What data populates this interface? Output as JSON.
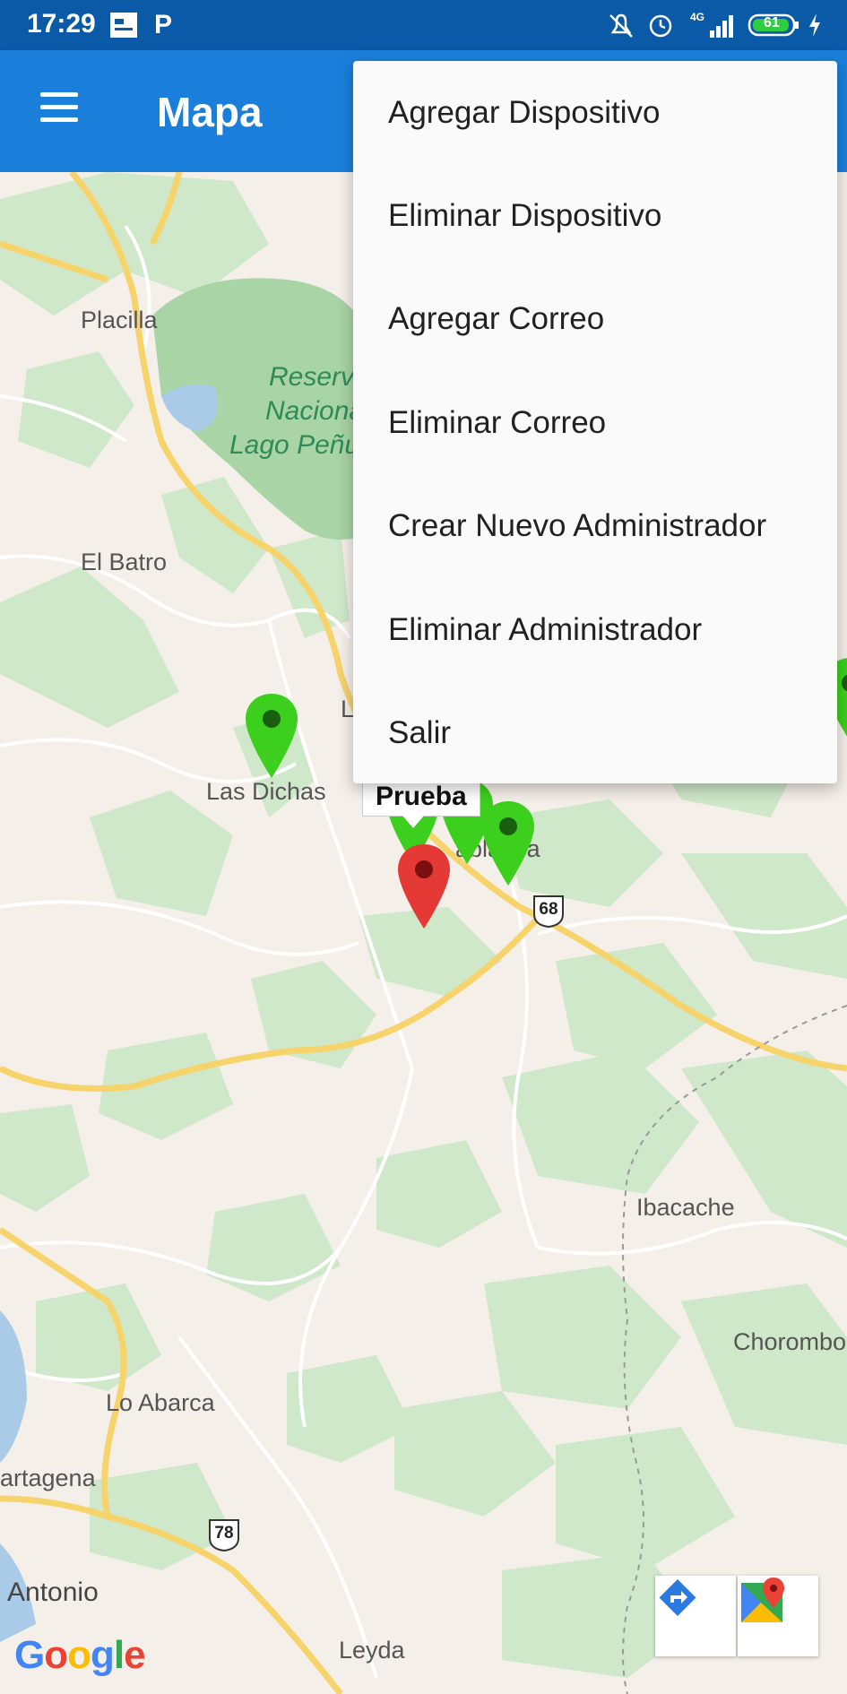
{
  "statusbar": {
    "time": "17:29",
    "network": "4G",
    "battery": "61",
    "icons": [
      "app-notification-icon",
      "parking-icon",
      "mute-icon",
      "alarm-icon",
      "signal-icon",
      "battery-icon",
      "charging-icon"
    ]
  },
  "appbar": {
    "title": "Mapa",
    "menu_icon": "hamburger-menu-icon",
    "color": "#1a7fdb"
  },
  "menu": {
    "items": [
      {
        "label": "Agregar Dispositivo"
      },
      {
        "label": "Eliminar Dispositivo"
      },
      {
        "label": "Agregar Correo"
      },
      {
        "label": "Eliminar Correo"
      },
      {
        "label": "Crear Nuevo Administrador"
      },
      {
        "label": "Eliminar Administrador"
      },
      {
        "label": "Salir"
      }
    ]
  },
  "map": {
    "labels": {
      "placilla": "Placilla",
      "reserva_1": "Reserva",
      "reserva_2": "Naciona",
      "reserva_3": "Lago Peñu",
      "el_batro": "El Batro",
      "las_dichas": "Las Dichas",
      "casablanca": "ablanca",
      "l_partial": "L",
      "ibacache": "Ibacache",
      "chorombo": "Chorombo",
      "lo_abarca": "Lo Abarca",
      "cartagena": "artagena",
      "antonio": "Antonio",
      "leyda": "Leyda"
    },
    "highway_68": "68",
    "highway_78": "78",
    "selected_marker_title": "Prueba",
    "marker_colors": {
      "device": "#3ccf1e",
      "selected": "#e53935"
    },
    "google_logo": "Google",
    "directions_button": "directions-icon",
    "open_maps_button": "google-maps-icon"
  }
}
